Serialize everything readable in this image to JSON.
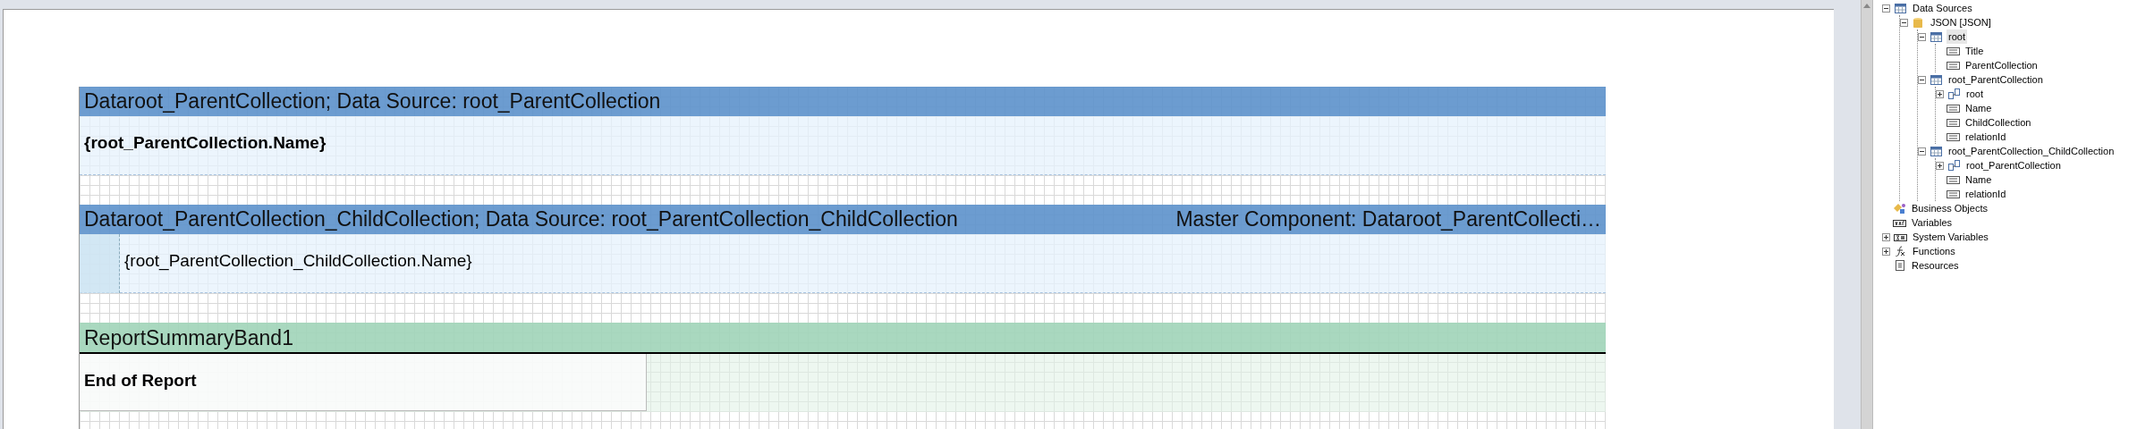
{
  "report": {
    "bands": [
      {
        "kind": "data",
        "header": "Dataroot_ParentCollection; Data Source: root_ParentCollection",
        "text": "{root_ParentCollection.Name}",
        "bold": true,
        "indent": false
      },
      {
        "kind": "data",
        "header": "Dataroot_ParentCollection_ChildCollection; Data Source: root_ParentCollection_ChildCollection",
        "master": "Master Component: Dataroot_ParentCollecti…",
        "text": "{root_ParentCollection_ChildCollection.Name}",
        "bold": false,
        "indent": true
      },
      {
        "kind": "summary",
        "header": "ReportSummaryBand1",
        "text": "End of Report",
        "bold": true,
        "indent": false
      }
    ]
  },
  "dictionary": {
    "items": [
      {
        "label": "Data Sources",
        "kind": "table",
        "expanded": true,
        "selected": false,
        "children": [
          {
            "label": "JSON [JSON]",
            "kind": "database",
            "expanded": true,
            "selected": false,
            "children": [
              {
                "label": "root",
                "kind": "table",
                "expanded": true,
                "selected": true,
                "children": [
                  {
                    "label": "Title",
                    "kind": "field",
                    "selected": false
                  },
                  {
                    "label": "ParentCollection",
                    "kind": "field",
                    "selected": false
                  }
                ]
              },
              {
                "label": "root_ParentCollection",
                "kind": "table",
                "expanded": true,
                "selected": false,
                "children": [
                  {
                    "label": "root",
                    "kind": "relation",
                    "expanded": false,
                    "selected": false
                  },
                  {
                    "label": "Name",
                    "kind": "field",
                    "selected": false
                  },
                  {
                    "label": "ChildCollection",
                    "kind": "field",
                    "selected": false
                  },
                  {
                    "label": "relationId",
                    "kind": "field",
                    "selected": false
                  }
                ]
              },
              {
                "label": "root_ParentCollection_ChildCollection",
                "kind": "table",
                "expanded": true,
                "selected": false,
                "children": [
                  {
                    "label": "root_ParentCollection",
                    "kind": "relation",
                    "expanded": false,
                    "selected": false
                  },
                  {
                    "label": "Name",
                    "kind": "field",
                    "selected": false
                  },
                  {
                    "label": "relationId",
                    "kind": "field",
                    "selected": false
                  }
                ]
              }
            ]
          }
        ]
      },
      {
        "label": "Business Objects",
        "kind": "business",
        "selected": false
      },
      {
        "label": "Variables",
        "kind": "variables",
        "selected": false
      },
      {
        "label": "System Variables",
        "kind": "sysvars",
        "expanded": false,
        "selected": false
      },
      {
        "label": "Functions",
        "kind": "functions",
        "expanded": false,
        "selected": false
      },
      {
        "label": "Resources",
        "kind": "resources",
        "selected": false
      }
    ]
  }
}
